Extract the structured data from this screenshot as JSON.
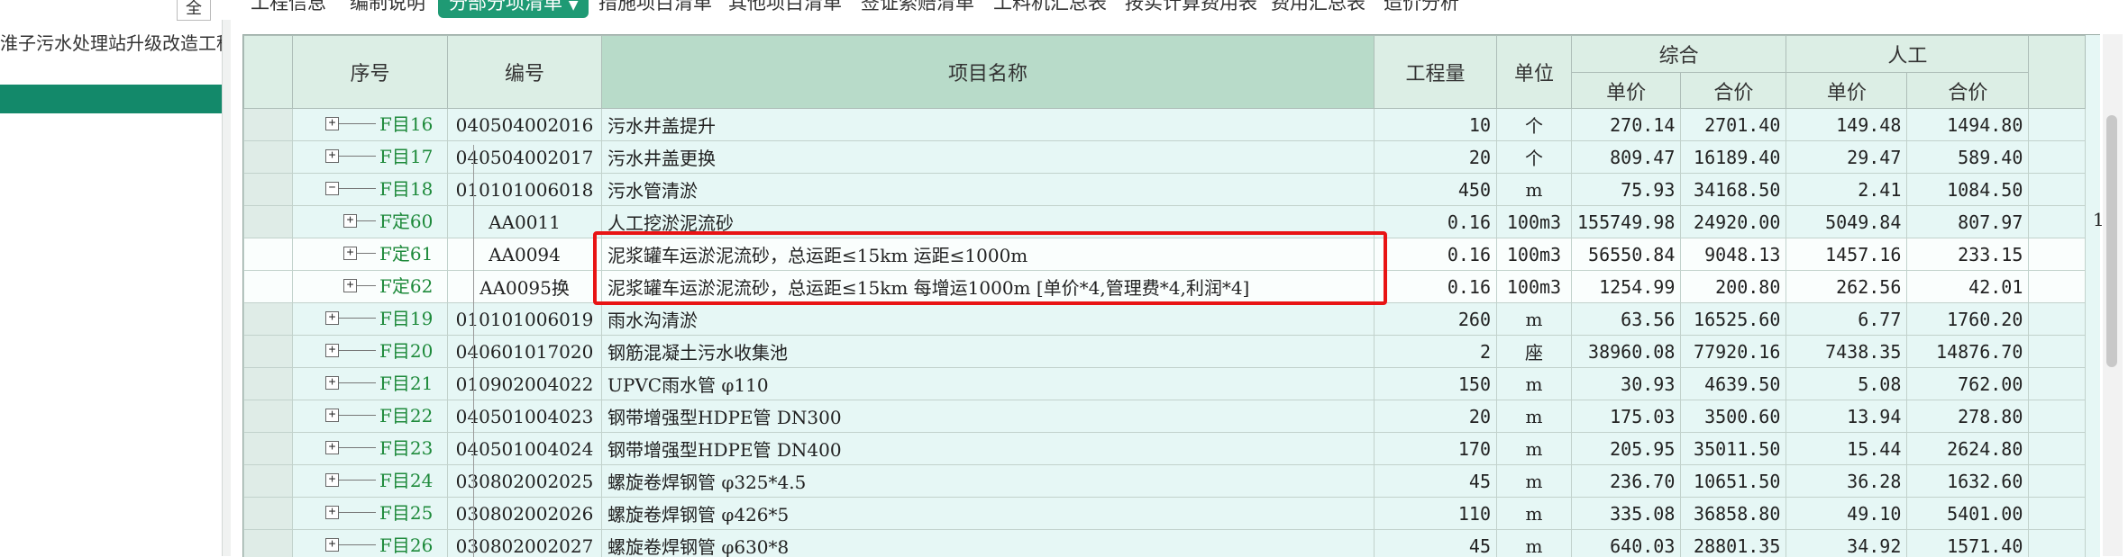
{
  "toolbar": {
    "tabs": [
      {
        "label": "工程信息",
        "active": false
      },
      {
        "label": "编制说明",
        "active": false
      },
      {
        "label": "分部分项清单",
        "active": true
      },
      {
        "label": "措施项目清单",
        "active": false
      },
      {
        "label": "其他项目清单",
        "active": false
      },
      {
        "label": "签证索赔清单",
        "active": false
      },
      {
        "label": "工料机汇总表",
        "active": false
      },
      {
        "label": "按实计算费用表",
        "active": false
      },
      {
        "label": "费用汇总表",
        "active": false
      },
      {
        "label": "造价分析",
        "active": false
      }
    ]
  },
  "left_panel": {
    "collapse_label": "全",
    "project_name": "淮子污水处理站升级改造工程"
  },
  "grid": {
    "headers": {
      "seq": "序号",
      "code": "编号",
      "name": "项目名称",
      "qty": "工程量",
      "unit": "单位",
      "composite": "综合",
      "labor": "人工",
      "unit_price": "单价",
      "total": "合价"
    },
    "rows": [
      {
        "seq": "F目16",
        "code": "040504002016",
        "name": "污水井盖提升",
        "qty": "10",
        "unit": "个",
        "c_price": "270.14",
        "c_total": "2701.40",
        "l_price": "149.48",
        "l_total": "1494.80"
      },
      {
        "seq": "F目17",
        "code": "040504002017",
        "name": "污水井盖更换",
        "qty": "20",
        "unit": "个",
        "c_price": "809.47",
        "c_total": "16189.40",
        "l_price": "29.47",
        "l_total": "589.40"
      },
      {
        "seq": "F目18",
        "code": "010101006018",
        "name": "污水管清淤",
        "qty": "450",
        "unit": "m",
        "c_price": "75.93",
        "c_total": "34168.50",
        "l_price": "2.41",
        "l_total": "1084.50"
      },
      {
        "seq": "F定60",
        "code": "AA0011",
        "name": "人工挖淤泥流砂",
        "qty": "0.16",
        "unit": "100m3",
        "c_price": "155749.98",
        "c_total": "24920.00",
        "l_price": "5049.84",
        "l_total": "807.97"
      },
      {
        "seq": "F定61",
        "code": "AA0094",
        "name": "泥浆罐车运淤泥流砂，总运距≤15km 运距≤1000m",
        "qty": "0.16",
        "unit": "100m3",
        "c_price": "56550.84",
        "c_total": "9048.13",
        "l_price": "1457.16",
        "l_total": "233.15"
      },
      {
        "seq": "F定62",
        "code": "AA0095换",
        "name": "泥浆罐车运淤泥流砂，总运距≤15km 每增运1000m [单价*4,管理费*4,利润*4]",
        "qty": "0.16",
        "unit": "100m3",
        "c_price": "1254.99",
        "c_total": "200.80",
        "l_price": "262.56",
        "l_total": "42.01"
      },
      {
        "seq": "F目19",
        "code": "010101006019",
        "name": "雨水沟清淤",
        "qty": "260",
        "unit": "m",
        "c_price": "63.56",
        "c_total": "16525.60",
        "l_price": "6.77",
        "l_total": "1760.20"
      },
      {
        "seq": "F目20",
        "code": "040601017020",
        "name": "钢筋混凝土污水收集池",
        "qty": "2",
        "unit": "座",
        "c_price": "38960.08",
        "c_total": "77920.16",
        "l_price": "7438.35",
        "l_total": "14876.70"
      },
      {
        "seq": "F目21",
        "code": "010902004022",
        "name": "UPVC雨水管 φ110",
        "qty": "150",
        "unit": "m",
        "c_price": "30.93",
        "c_total": "4639.50",
        "l_price": "5.08",
        "l_total": "762.00"
      },
      {
        "seq": "F目22",
        "code": "040501004023",
        "name": "钢带增强型HDPE管 DN300",
        "qty": "20",
        "unit": "m",
        "c_price": "175.03",
        "c_total": "3500.60",
        "l_price": "13.94",
        "l_total": "278.80"
      },
      {
        "seq": "F目23",
        "code": "040501004024",
        "name": "钢带增强型HDPE管 DN400",
        "qty": "170",
        "unit": "m",
        "c_price": "205.95",
        "c_total": "35011.50",
        "l_price": "15.44",
        "l_total": "2624.80"
      },
      {
        "seq": "F目24",
        "code": "030802002025",
        "name": "螺旋卷焊钢管  φ325*4.5",
        "qty": "45",
        "unit": "m",
        "c_price": "236.70",
        "c_total": "10651.50",
        "l_price": "36.28",
        "l_total": "1632.60"
      },
      {
        "seq": "F目25",
        "code": "030802002026",
        "name": "螺旋卷焊钢管  φ426*5",
        "qty": "110",
        "unit": "m",
        "c_price": "335.08",
        "c_total": "36858.80",
        "l_price": "49.10",
        "l_total": "5401.00"
      },
      {
        "seq": "F目26",
        "code": "030802002027",
        "name": "螺旋卷焊钢管  φ630*8",
        "qty": "45",
        "unit": "m",
        "c_price": "640.03",
        "c_total": "28801.35",
        "l_price": "34.92",
        "l_total": "1571.40"
      }
    ],
    "overflow_char": "1"
  },
  "colors": {
    "accent": "#1f9a74",
    "project_bar": "#13896a",
    "row_bg": "#e6f7f5",
    "highlight_border": "#e81414",
    "seq_text": "#1e8a3b"
  }
}
